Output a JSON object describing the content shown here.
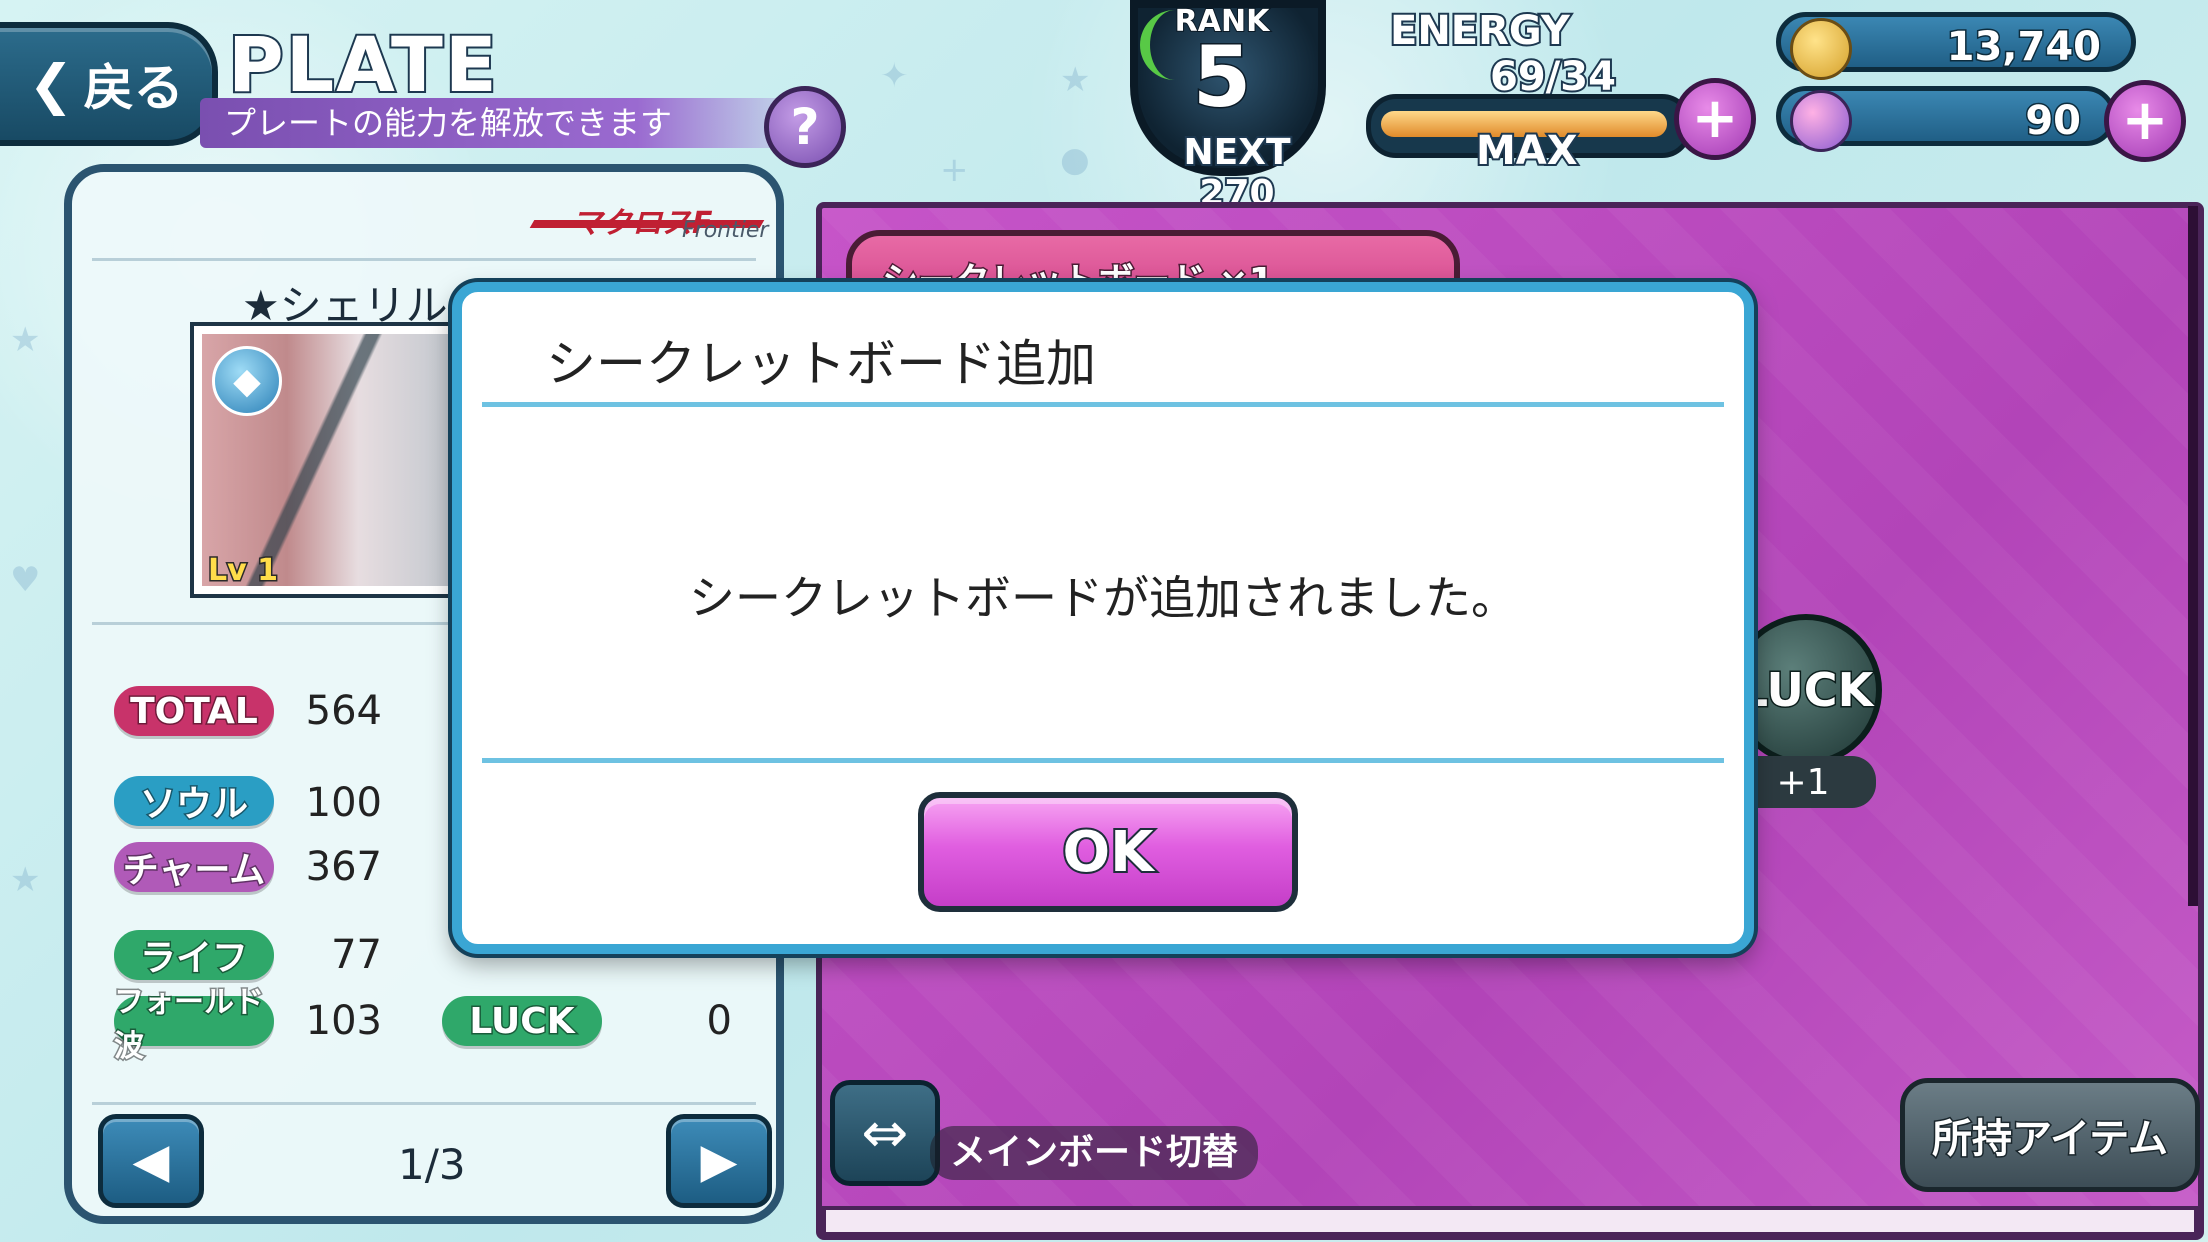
{
  "header": {
    "back_label": "戻る",
    "title": "PLATE",
    "subtitle": "プレートの能力を解放できます",
    "help_label": "?"
  },
  "rank": {
    "label": "RANK",
    "value": "5",
    "next": "NEXT 270"
  },
  "energy": {
    "label": "ENERGY",
    "value": "69/34",
    "status": "MAX",
    "fill_fraction": 1.0
  },
  "currency": {
    "coins": "13,740",
    "gems": "90"
  },
  "left_panel": {
    "character_name": "★シェリル",
    "card_level": "Lv 1",
    "stats": [
      {
        "label": "TOTAL",
        "value": "564"
      },
      {
        "label": "ソウル",
        "value": "100"
      },
      {
        "label": "チャーム",
        "value": "367"
      },
      {
        "label": "ライフ",
        "value": "77"
      },
      {
        "label": "フォールド波",
        "value": "103"
      }
    ],
    "luck": {
      "label": "LUCK",
      "value": "0"
    },
    "page": "1/3"
  },
  "right_panel": {
    "board_tab": "シークレットボード ×1",
    "luck_node": "LUCK",
    "luck_bonus": "+1",
    "switch_label": "メインボード切替",
    "items_button": "所持アイテム"
  },
  "dialog": {
    "title": "シークレットボード追加",
    "message": "シークレットボードが追加されました。",
    "ok_label": "OK"
  },
  "colors": {
    "accent_blue": "#3aa6d4",
    "ok_pink": "#e05ee0",
    "board_magenta": "#b244b8"
  }
}
